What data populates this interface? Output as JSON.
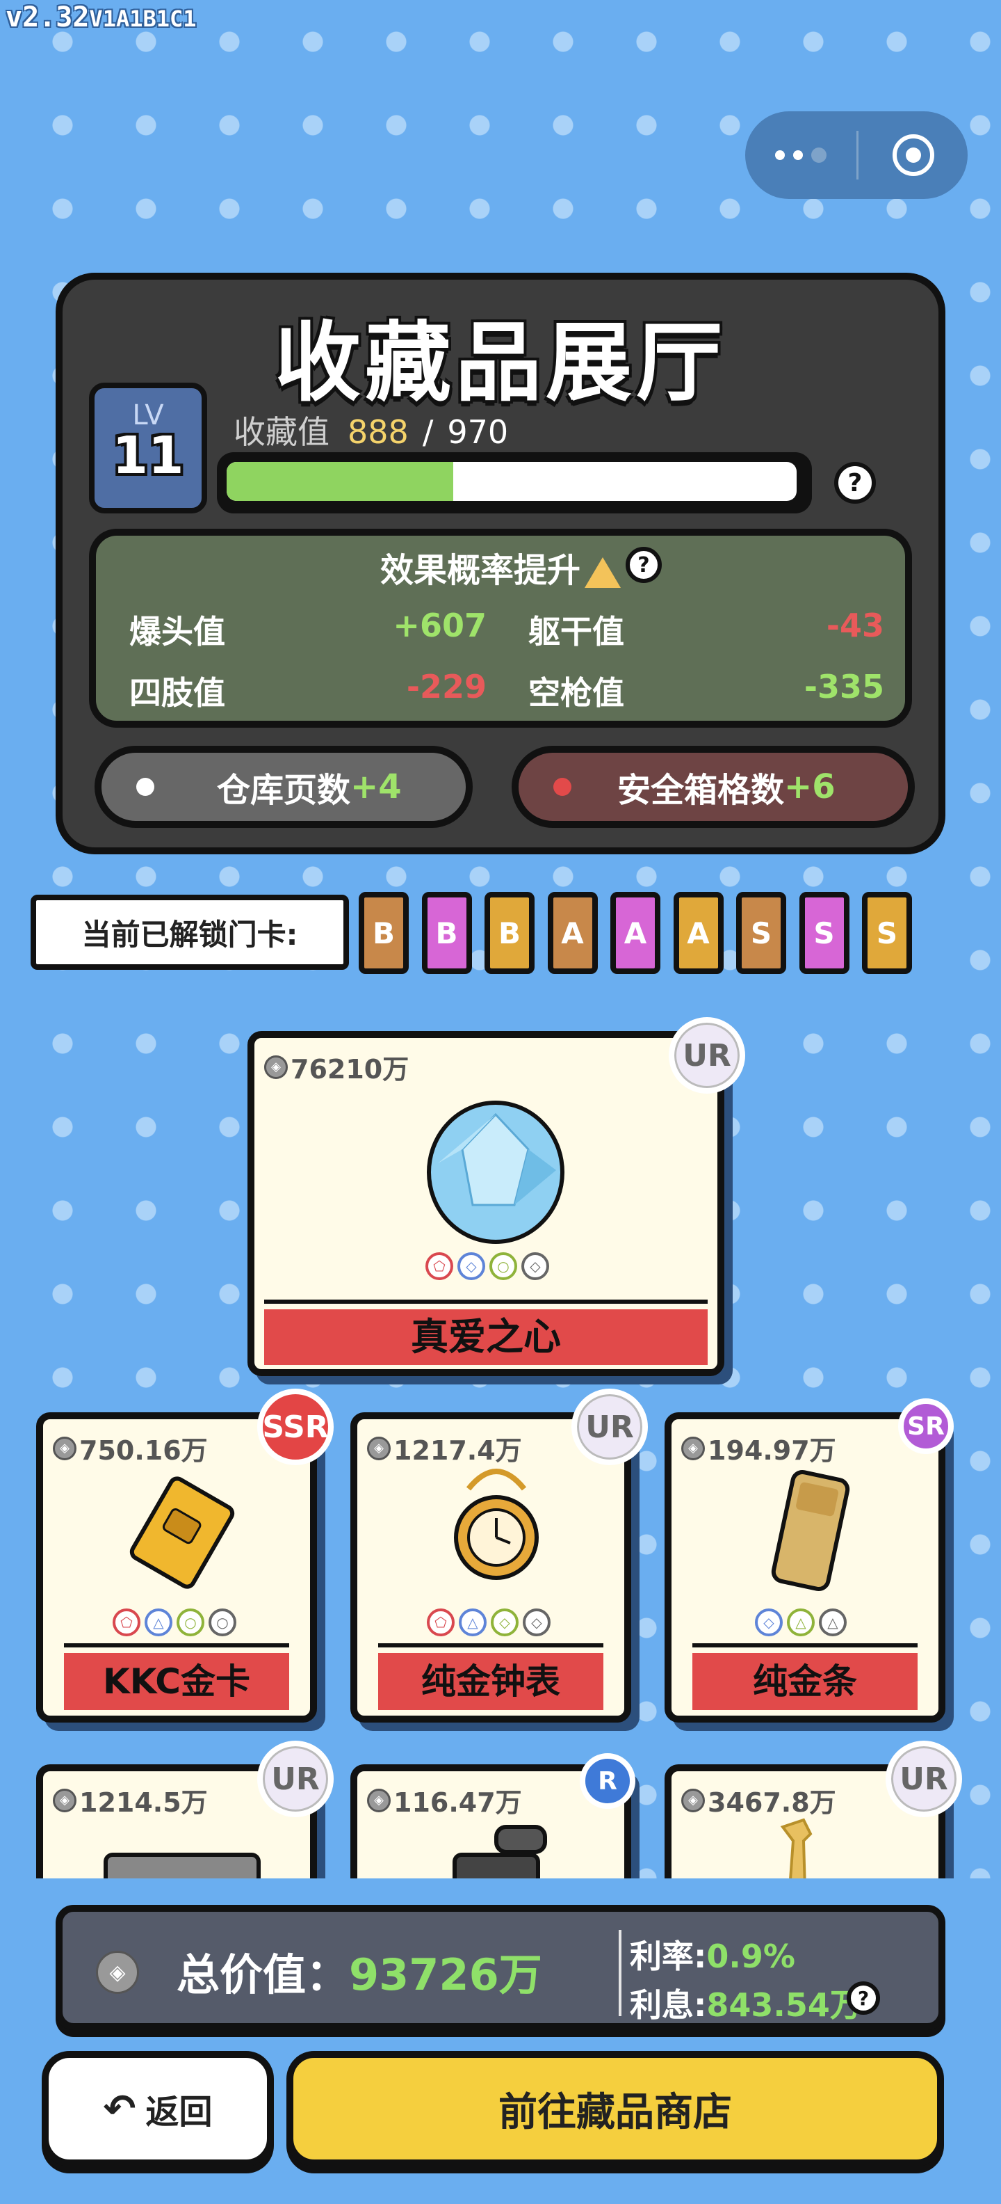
{
  "version": {
    "main": "v2.32",
    "suffix": "V1A1B1C1"
  },
  "header": {
    "title": "收藏品展厅"
  },
  "level": {
    "label": "LV",
    "value": "11"
  },
  "collection": {
    "label": "收藏值",
    "current": "888",
    "separator": "/",
    "max": "970",
    "progress_fraction": 0.398
  },
  "effect": {
    "title": "效果概率提升",
    "stats": [
      {
        "label": "爆头值",
        "value": "+607",
        "color": "#9fe36a"
      },
      {
        "label": "躯干值",
        "value": "-43",
        "color": "#e85a5a"
      },
      {
        "label": "四肢值",
        "value": "-229",
        "color": "#e85a5a"
      },
      {
        "label": "空枪值",
        "value": "-335",
        "color": "#9fe36a"
      }
    ]
  },
  "bonuses": [
    {
      "label": "仓库页数",
      "value": "+4",
      "dot_color": "#ffffff",
      "bg": "#676767"
    },
    {
      "label": "安全箱格数",
      "value": "+6",
      "dot_color": "#e24a4a",
      "bg": "#6e4444"
    }
  ],
  "keycards": {
    "label": "当前已解锁门卡:",
    "cards": [
      {
        "letter": "B",
        "color": "#c8884a"
      },
      {
        "letter": "B",
        "color": "#d766d6"
      },
      {
        "letter": "B",
        "color": "#e0a83a"
      },
      {
        "letter": "A",
        "color": "#c8884a"
      },
      {
        "letter": "A",
        "color": "#d766d6"
      },
      {
        "letter": "A",
        "color": "#e0a83a"
      },
      {
        "letter": "S",
        "color": "#c8884a"
      },
      {
        "letter": "S",
        "color": "#d766d6"
      },
      {
        "letter": "S",
        "color": "#e0a83a"
      }
    ]
  },
  "featured": {
    "price": "76210万",
    "name": "真爱之心",
    "rarity": "UR"
  },
  "items": [
    {
      "price": "750.16万",
      "name": "KKC金卡",
      "rarity": "SSR",
      "gems": [
        "r",
        "b",
        "g",
        "w"
      ]
    },
    {
      "price": "1217.4万",
      "name": "纯金钟表",
      "rarity": "UR",
      "gems": [
        "r",
        "b",
        "g",
        "w"
      ]
    },
    {
      "price": "194.97万",
      "name": "纯金条",
      "rarity": "SR",
      "gems": [
        "b",
        "g",
        "w"
      ]
    },
    {
      "price": "1214.5万",
      "name": "",
      "rarity": "UR"
    },
    {
      "price": "116.47万",
      "name": "",
      "rarity": "R"
    },
    {
      "price": "3467.8万",
      "name": "",
      "rarity": "UR"
    }
  ],
  "summary": {
    "total_label": "总价值：",
    "total_value": "93726万",
    "rate_label": "利率:",
    "rate_value": "0.9%",
    "interest_label": "利息:",
    "interest_value": "843.54万"
  },
  "buttons": {
    "back": "返回",
    "shop": "前往藏品商店"
  }
}
